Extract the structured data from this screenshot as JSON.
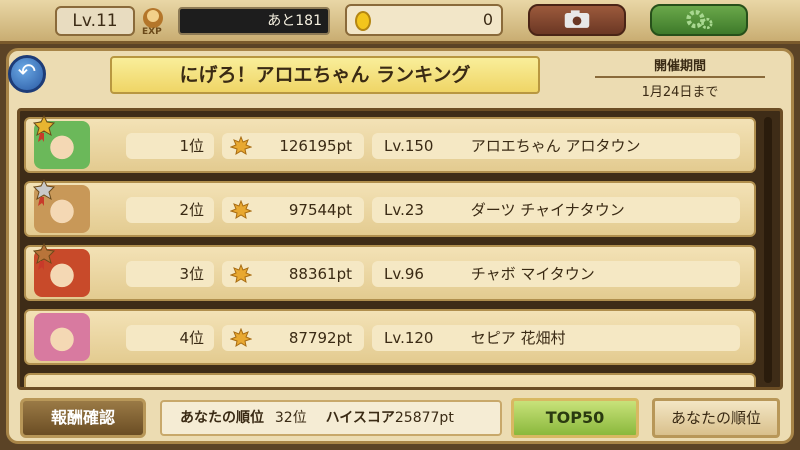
{
  "topbar": {
    "level": "Lv.11",
    "exp_label": "EXP",
    "exp_remaining": "あと181",
    "coins": "0",
    "camera_icon": "camera-icon",
    "settings_icon": "gear-icon"
  },
  "title": "にげろ！アロエちゃん ランキング",
  "period": {
    "label": "開催期間",
    "value": "1月24日まで"
  },
  "rows": [
    {
      "rank": "1位",
      "points": "126195pt",
      "level": "Lv.150",
      "name": "アロエちゃん アロタウン",
      "medal_color": "#e8b530",
      "avatar_color": "#6bb85a"
    },
    {
      "rank": "2位",
      "points": "97544pt",
      "level": "Lv.23",
      "name": "ダーツ チャイナタウン",
      "medal_color": "#c8c8c8",
      "avatar_color": "#c89858"
    },
    {
      "rank": "3位",
      "points": "88361pt",
      "level": "Lv.96",
      "name": "チャボ マイタウン",
      "medal_color": "#b8743a",
      "avatar_color": "#c84a2a"
    },
    {
      "rank": "4位",
      "points": "87792pt",
      "level": "Lv.120",
      "name": "セピア 花畑村",
      "medal_color": "",
      "avatar_color": "#d87aa0"
    }
  ],
  "bottom": {
    "reward_button": "報酬確認",
    "my_rank_label": "あなたの順位",
    "my_rank_value": "32位",
    "highscore_label": "ハイスコア",
    "highscore_value": "25877pt",
    "top50_button": "TOP50",
    "my_position_button": "あなたの順位"
  }
}
